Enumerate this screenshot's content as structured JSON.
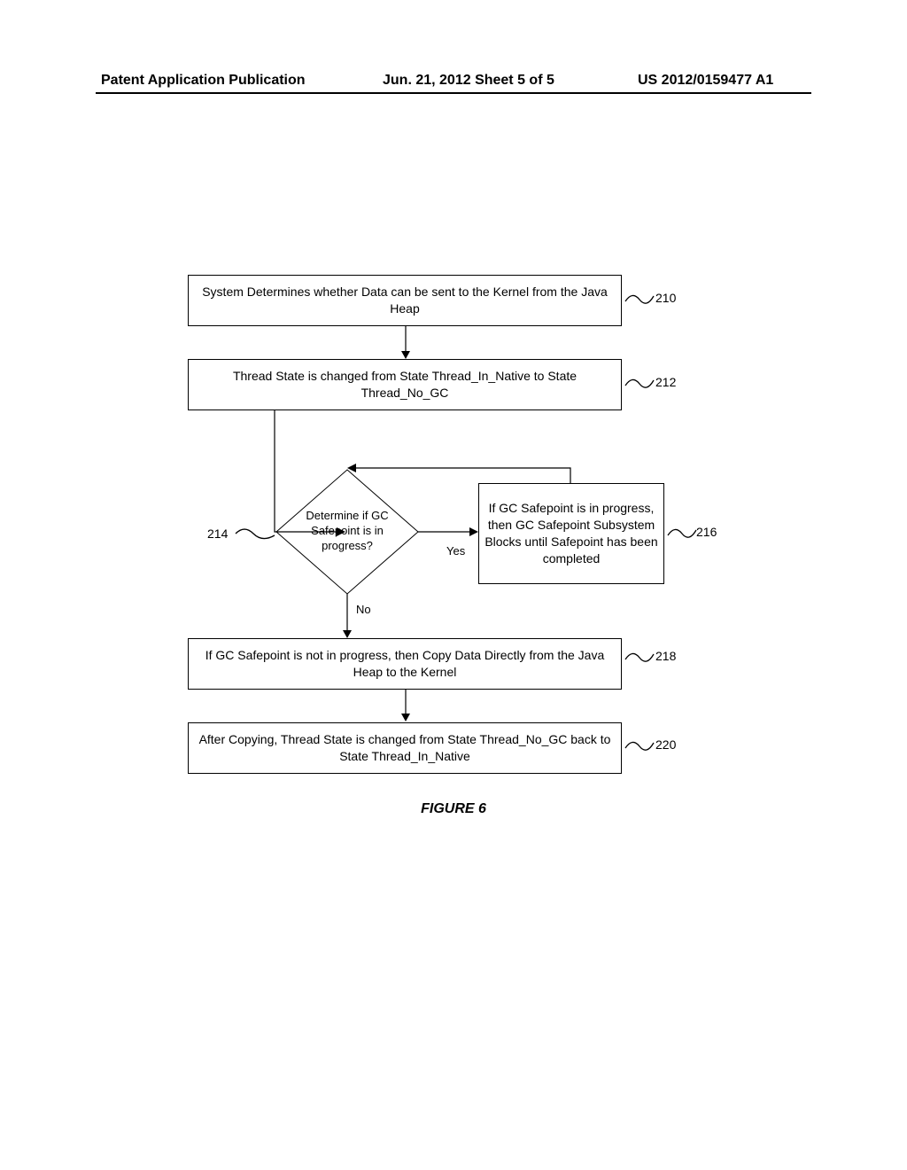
{
  "header": {
    "left": "Patent Application Publication",
    "center": "Jun. 21, 2012   Sheet 5 of 5",
    "right": "US 2012/0159477 A1"
  },
  "flow": {
    "step210": "System Determines whether Data can be sent to the Kernel from the Java Heap",
    "step212": "Thread State is changed from State Thread_In_Native to State Thread_No_GC",
    "decision214": "Determine if GC Safepoint is in progress?",
    "step216": "If GC Safepoint is in progress, then GC Safepoint Subsystem Blocks until Safepoint has been completed",
    "step218": "If GC Safepoint is not in progress, then Copy Data Directly from the Java Heap to the Kernel",
    "step220": "After Copying, Thread State is changed from State Thread_No_GC back to State Thread_In_Native",
    "yes": "Yes",
    "no": "No"
  },
  "refs": {
    "r210": "210",
    "r212": "212",
    "r214": "214",
    "r216": "216",
    "r218": "218",
    "r220": "220"
  },
  "caption": "FIGURE 6"
}
